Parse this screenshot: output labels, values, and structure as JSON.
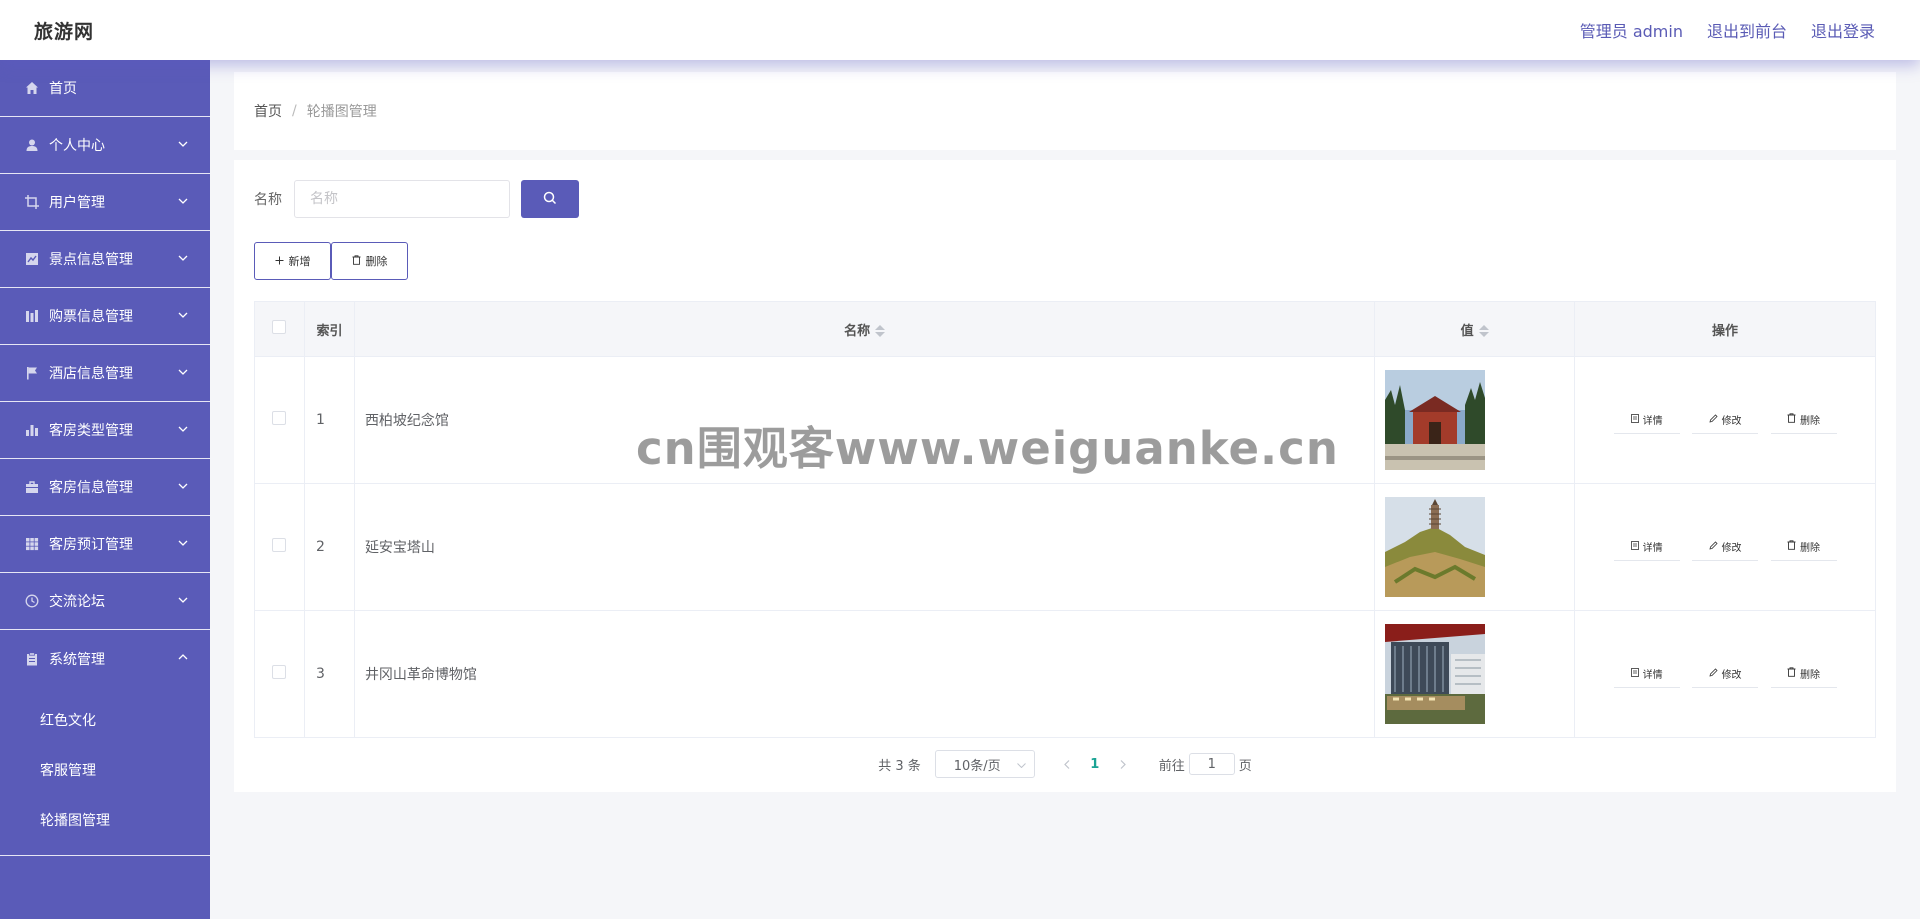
{
  "header": {
    "logo": "旅游网",
    "links": [
      "管理员 admin",
      "退出到前台",
      "退出登录"
    ]
  },
  "sidebar": {
    "items": [
      {
        "label": "首页",
        "icon": "home-icon",
        "expandable": false
      },
      {
        "label": "个人中心",
        "icon": "user-icon",
        "expandable": true
      },
      {
        "label": "用户管理",
        "icon": "crop-icon",
        "expandable": true
      },
      {
        "label": "景点信息管理",
        "icon": "chart-icon",
        "expandable": true
      },
      {
        "label": "购票信息管理",
        "icon": "bars-icon",
        "expandable": true
      },
      {
        "label": "酒店信息管理",
        "icon": "flag-icon",
        "expandable": true
      },
      {
        "label": "客房类型管理",
        "icon": "bar-chart-icon",
        "expandable": true
      },
      {
        "label": "客房信息管理",
        "icon": "briefcase-icon",
        "expandable": true
      },
      {
        "label": "客房预订管理",
        "icon": "grid-icon",
        "expandable": true
      },
      {
        "label": "交流论坛",
        "icon": "clock-icon",
        "expandable": true
      },
      {
        "label": "系统管理",
        "icon": "clipboard-icon",
        "expandable": true,
        "expanded": true
      }
    ],
    "subitems": [
      "红色文化",
      "客服管理",
      "轮播图管理"
    ]
  },
  "breadcrumb": {
    "home": "首页",
    "separator": "/",
    "current": "轮播图管理"
  },
  "search": {
    "label": "名称",
    "placeholder": "名称"
  },
  "actions": {
    "add": "新增",
    "delete": "删除"
  },
  "table": {
    "headers": {
      "index": "索引",
      "name": "名称",
      "value": "值",
      "ops": "操作"
    },
    "rows": [
      {
        "index": "1",
        "name": "西柏坡纪念馆",
        "image": "memorial-hall-photo"
      },
      {
        "index": "2",
        "name": "延安宝塔山",
        "image": "pagoda-hill-photo"
      },
      {
        "index": "3",
        "name": "井冈山革命博物馆",
        "image": "museum-photo"
      }
    ],
    "row_actions": [
      "详情",
      "修改",
      "删除"
    ]
  },
  "pagination": {
    "total": "共 3 条",
    "page_size": "10条/页",
    "current": "1",
    "goto_label": "前往",
    "goto_value": "1",
    "page_unit": "页"
  },
  "watermark": "cn围观客www.weiguanke.cn",
  "colors": {
    "primary": "#5a5bb8",
    "pagination_active": "#1aa394"
  }
}
